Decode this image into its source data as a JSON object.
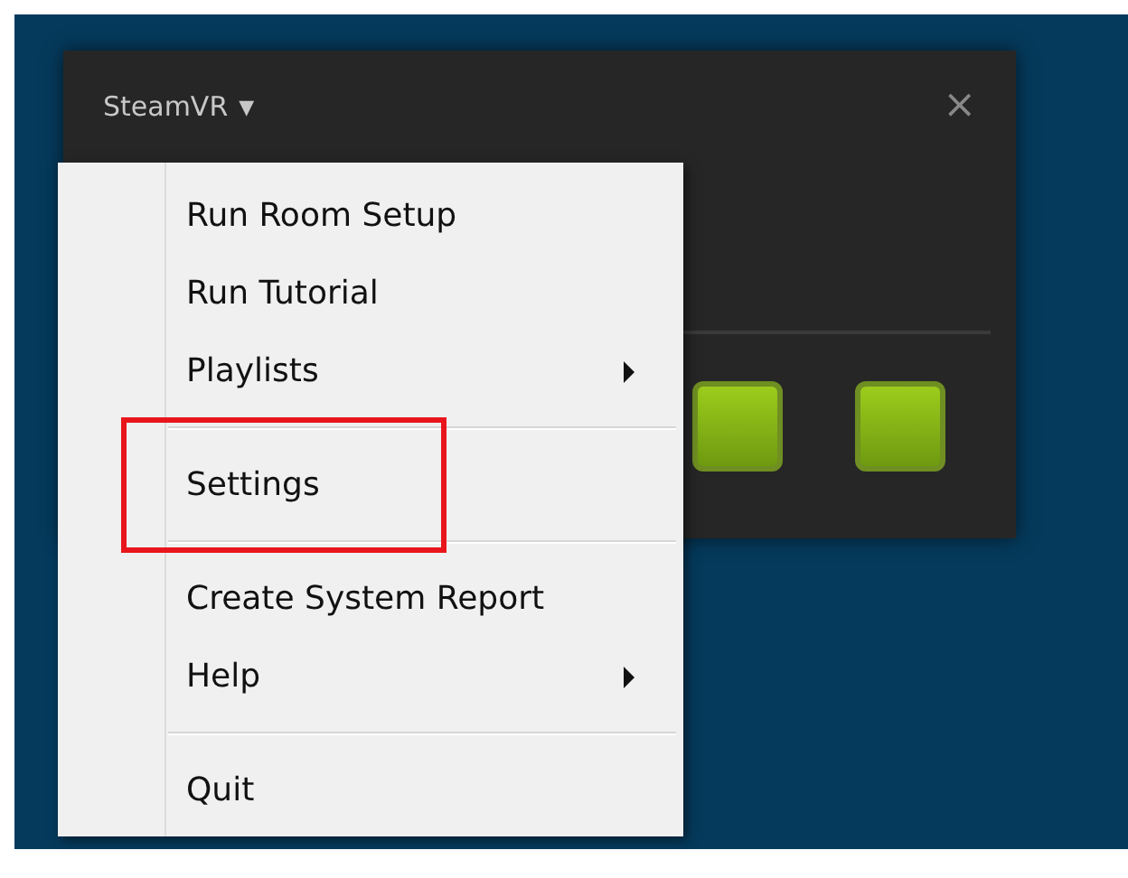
{
  "window": {
    "title": "SteamVR",
    "title_caret": "▼",
    "close": "×",
    "devices": [
      {
        "kind": "tile"
      },
      {
        "kind": "tile"
      }
    ]
  },
  "menu": {
    "items": [
      {
        "kind": "item",
        "label": "Run Room Setup",
        "submenu": false,
        "highlighted": false
      },
      {
        "kind": "item",
        "label": "Run Tutorial",
        "submenu": false,
        "highlighted": false
      },
      {
        "kind": "item",
        "label": "Playlists",
        "submenu": true,
        "highlighted": false
      },
      {
        "kind": "separator"
      },
      {
        "kind": "item",
        "label": "Settings",
        "submenu": false,
        "highlighted": true
      },
      {
        "kind": "separator"
      },
      {
        "kind": "item",
        "label": "Create System Report",
        "submenu": false,
        "highlighted": false
      },
      {
        "kind": "item",
        "label": "Help",
        "submenu": true,
        "highlighted": false
      },
      {
        "kind": "separator"
      },
      {
        "kind": "item",
        "label": "Quit",
        "submenu": false,
        "highlighted": false
      }
    ]
  }
}
